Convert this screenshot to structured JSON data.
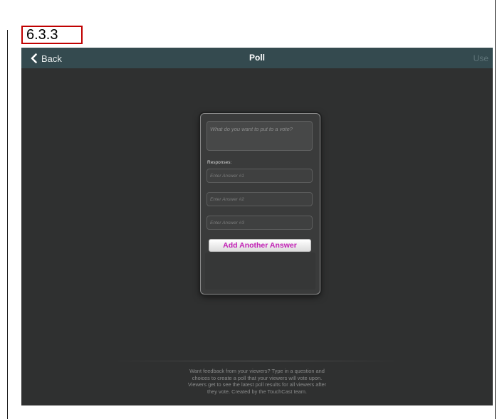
{
  "step_label": "6.3.3",
  "navbar": {
    "back_label": "Back",
    "title": "Poll",
    "use_label": "Use"
  },
  "poll": {
    "question_placeholder": "What do you want to put to a vote?",
    "responses_label": "Responses:",
    "answers": [
      {
        "placeholder": "Enter Answer #1"
      },
      {
        "placeholder": "Enter Answer #2"
      },
      {
        "placeholder": "Enter Answer #3"
      }
    ],
    "add_button_label": "Add Another Answer"
  },
  "footer": {
    "lines": [
      "Want feedback from your viewers? Type in a question and",
      "choices to create a poll that your viewers will vote upon.",
      "Viewers get to see the latest poll results for all viewers after",
      "they vote. Created by the TouchCast team."
    ]
  },
  "colors": {
    "navbar_bg": "#344a4f",
    "screen_bg": "#2f3030",
    "accent_magenta": "#c21fb5",
    "step_border": "#c00000"
  }
}
